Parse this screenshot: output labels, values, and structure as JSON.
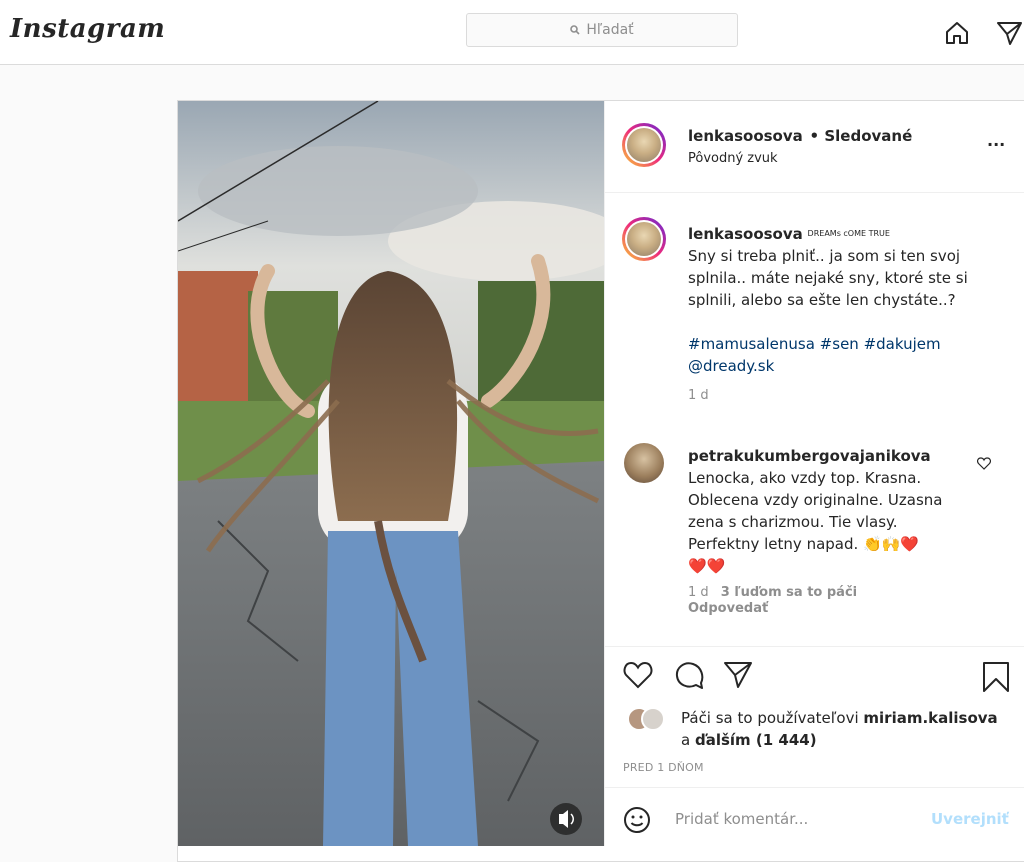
{
  "app": {
    "logo_text": "Instagram"
  },
  "search": {
    "placeholder": "Hľadať",
    "icon": "search-icon"
  },
  "post": {
    "author": "lenkasoosova",
    "follow_state": "• Sledované",
    "audio": "Pôvodný zvuk",
    "more_label": "...",
    "caption": {
      "username": "lenkasoosova",
      "badge": "DREAMs cOME TRUE",
      "line1": "Sny si treba plniť.. ja som si ten svoj",
      "line2": "splnila.. máte nejaké sny, ktoré ste si",
      "line3": "splnili, alebo sa ešte len chystáte..?",
      "hashtags": "#mamusalenusa #sen #dakujem",
      "mention": "@dready.sk",
      "time": "1 d"
    },
    "comments": [
      {
        "username": "petrakukumbergovajanikova",
        "line1": "Lenocka, ako vzdy top. Krasna.",
        "line2": "Oblecena vzdy originalne. Uzasna",
        "line3": "zena s charizmou. Tie vlasy.",
        "line4": "Perfektny letny napad. 👏🙌❤️",
        "line5": "❤️❤️",
        "time": "1 d",
        "likes": "3 ľuďom sa to páči",
        "reply": "Odpovedať"
      }
    ],
    "likes": {
      "prefix": "Páči sa to používateľovi",
      "user": "miriam.kalisova",
      "and": "a",
      "others": "ďalším (1 444)"
    },
    "timestamp": "PRED 1 DŇOM",
    "add_comment": {
      "placeholder": "Pridať komentár...",
      "post_label": "Uverejniť"
    }
  },
  "colors": {
    "link": "#00376b",
    "post_button": "#b2dffc",
    "heart": "#ed4956"
  }
}
